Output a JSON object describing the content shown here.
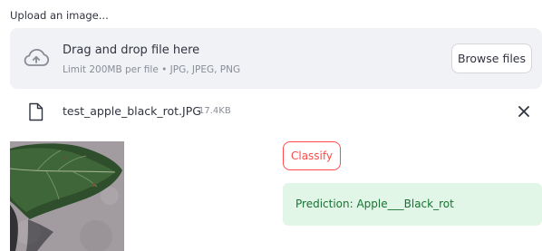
{
  "uploader": {
    "label": "Upload an image...",
    "dropzone_title": "Drag and drop file here",
    "dropzone_hint": "Limit 200MB per file • JPG, JPEG, PNG",
    "browse_label": "Browse files",
    "upload_icon": "cloud-upload-icon"
  },
  "file": {
    "name": "test_apple_black_rot.JPG",
    "size": "17.4KB",
    "file_icon": "file-icon",
    "close_icon": "close-icon"
  },
  "actions": {
    "classify_label": "Classify"
  },
  "result": {
    "prediction": "Prediction: Apple___Black_rot"
  },
  "colors": {
    "accent": "#ff4b4b",
    "success_bg": "#e2f6e7",
    "success_text": "#177233",
    "dropzone_bg": "#f0f2f6"
  }
}
